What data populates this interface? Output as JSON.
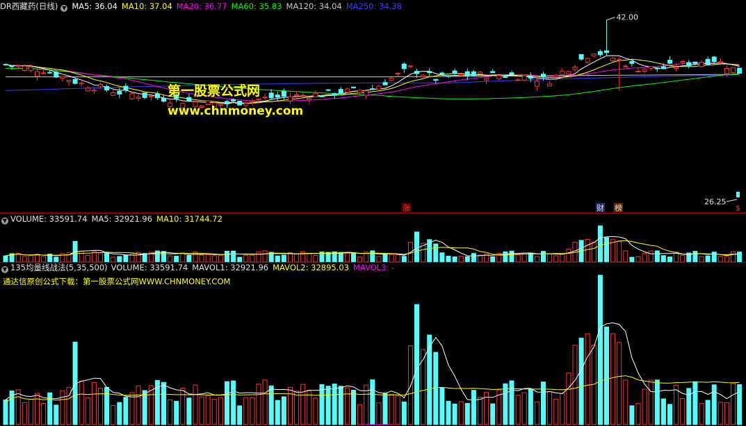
{
  "main_pane": {
    "title": "DR西藏药(日线)",
    "indicators": [
      {
        "label": "MA5",
        "value": "36.04",
        "color": "#ffffff"
      },
      {
        "label": "MA10",
        "value": "37.04",
        "color": "#ffff00"
      },
      {
        "label": "MA20",
        "value": "36.77",
        "color": "#ff00ff"
      },
      {
        "label": "MA60",
        "value": "35.83",
        "color": "#00ff00"
      },
      {
        "label": "MA120",
        "value": "34.04",
        "color": "#c8c8c8"
      },
      {
        "label": "MA250",
        "value": "34.38",
        "color": "#0000ff"
      }
    ],
    "high_label": "42.00",
    "low_label": "26.25",
    "event_markers": [
      "涨",
      "财",
      "榜",
      "$"
    ],
    "watermark_line1": "第一股票公式网",
    "watermark_line2": "www.chnmoney.com"
  },
  "volume_pane": {
    "title": "VOLUME: 33591.74",
    "ma5": "MA5: 32921.96",
    "ma10": "MA10: 31744.72"
  },
  "indicator_pane": {
    "title": "135均量线战法(5,35,500)",
    "volume": "VOLUME: 33591.74",
    "mavol1": "MAVOL1: 32921.96",
    "mavol2": "MAVOL2: 32895.03",
    "mavol3": "MAVOL3: -",
    "note": "通达信原创公式下载：第一股票公式网WWW.CHNMONEY.COM"
  },
  "colors": {
    "up": "#ff3232",
    "down": "#54fcfc",
    "background": "#000000",
    "grid": "#b00000"
  }
}
